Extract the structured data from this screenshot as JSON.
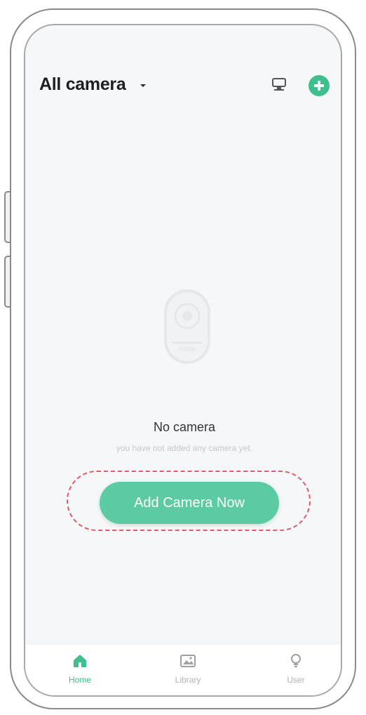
{
  "header": {
    "title": "All camera",
    "monitor_icon": "monitor-icon",
    "add_icon": "plus-circle-icon"
  },
  "empty_state": {
    "title": "No camera",
    "subtitle": "you have not added any camera yet."
  },
  "primary_button": {
    "label": "Add Camera Now"
  },
  "bottom_nav": {
    "items": [
      {
        "label": "Home",
        "icon": "home-icon",
        "active": true
      },
      {
        "label": "Library",
        "icon": "image-icon",
        "active": false
      },
      {
        "label": "User",
        "icon": "user-icon",
        "active": false
      }
    ]
  },
  "colors": {
    "accent": "#3fbf8e",
    "button": "#5ccaa2",
    "highlight": "#e05a6a",
    "background": "#f6f7f8"
  }
}
